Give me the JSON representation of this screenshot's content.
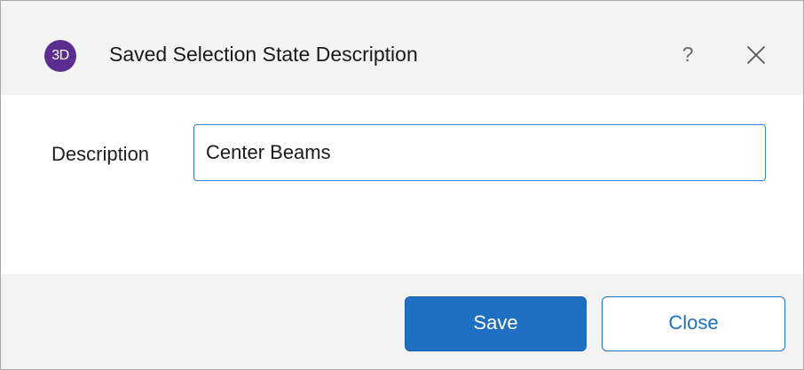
{
  "window": {
    "app_icon_text": "3D",
    "title": "Saved Selection State Description",
    "help_label": "?"
  },
  "form": {
    "description_label": "Description",
    "description_value": "Center Beams"
  },
  "footer": {
    "save_label": "Save",
    "close_label": "Close"
  },
  "colors": {
    "app_icon_bg": "#5b2d8e",
    "accent": "#1f6fc2",
    "titlebar_bg": "#f3f3f3"
  }
}
